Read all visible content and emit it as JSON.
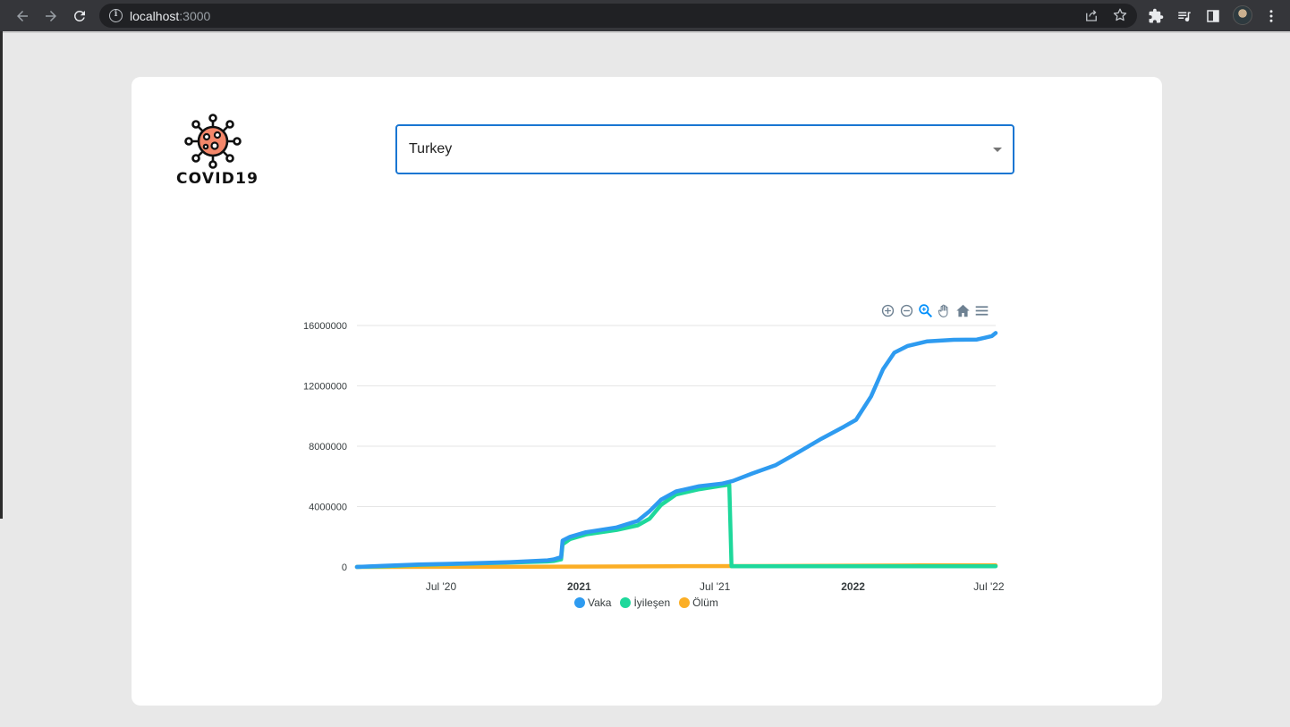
{
  "browser": {
    "url_host": "localhost",
    "url_port": ":3000"
  },
  "app": {
    "logo_text": "COVID19",
    "country_select": {
      "value": "Turkey"
    }
  },
  "chart_toolbar": [
    "zoom-in-icon",
    "zoom-out-icon",
    "selection-zoom-icon",
    "pan-icon",
    "reset-home-icon",
    "menu-icon"
  ],
  "colors": {
    "vaka": "#2e9bf0",
    "iyilesen": "#1ed89b",
    "olum": "#fbae25",
    "select_border": "#1976d2"
  },
  "chart_data": {
    "type": "line",
    "y_ticks": [
      "0",
      "4000000",
      "8000000",
      "12000000",
      "16000000"
    ],
    "x_ticks": [
      {
        "label": "Jul '20",
        "date": "2020-07-01",
        "bold": false
      },
      {
        "label": "2021",
        "date": "2021-01-01",
        "bold": true
      },
      {
        "label": "Jul '21",
        "date": "2021-07-01",
        "bold": false
      },
      {
        "label": "2022",
        "date": "2022-01-01",
        "bold": true
      },
      {
        "label": "Jul '22",
        "date": "2022-07-01",
        "bold": false
      }
    ],
    "ylim": [
      0,
      16000000
    ],
    "xlim": [
      "2020-03-11",
      "2022-07-10"
    ],
    "legend_position": "bottom",
    "series": [
      {
        "name": "Vaka",
        "points": [
          [
            "2020-03-11",
            0
          ],
          [
            "2020-04-15",
            70000
          ],
          [
            "2020-06-01",
            165000
          ],
          [
            "2020-08-01",
            232000
          ],
          [
            "2020-10-01",
            320000
          ],
          [
            "2020-11-20",
            440000
          ],
          [
            "2020-11-28",
            500000
          ],
          [
            "2020-12-08",
            650000
          ],
          [
            "2020-12-10",
            1750000
          ],
          [
            "2020-12-20",
            2000000
          ],
          [
            "2021-01-10",
            2300000
          ],
          [
            "2021-02-20",
            2620000
          ],
          [
            "2021-03-20",
            3050000
          ],
          [
            "2021-04-05",
            3700000
          ],
          [
            "2021-04-20",
            4450000
          ],
          [
            "2021-05-10",
            5000000
          ],
          [
            "2021-06-10",
            5350000
          ],
          [
            "2021-07-10",
            5520000
          ],
          [
            "2021-07-25",
            5700000
          ],
          [
            "2021-08-20",
            6200000
          ],
          [
            "2021-09-20",
            6750000
          ],
          [
            "2021-10-20",
            7600000
          ],
          [
            "2021-11-20",
            8500000
          ],
          [
            "2021-12-20",
            9300000
          ],
          [
            "2022-01-05",
            9750000
          ],
          [
            "2022-01-25",
            11300000
          ],
          [
            "2022-02-10",
            13100000
          ],
          [
            "2022-02-25",
            14200000
          ],
          [
            "2022-03-15",
            14650000
          ],
          [
            "2022-04-10",
            14950000
          ],
          [
            "2022-05-15",
            15050000
          ],
          [
            "2022-06-15",
            15070000
          ],
          [
            "2022-06-25",
            15180000
          ],
          [
            "2022-07-05",
            15300000
          ],
          [
            "2022-07-10",
            15500000
          ]
        ]
      },
      {
        "name": "İyileşen",
        "points": [
          [
            "2020-03-11",
            0
          ],
          [
            "2020-04-15",
            40000
          ],
          [
            "2020-06-01",
            140000
          ],
          [
            "2020-08-01",
            215000
          ],
          [
            "2020-10-01",
            290000
          ],
          [
            "2020-11-20",
            360000
          ],
          [
            "2020-11-28",
            390000
          ],
          [
            "2020-12-08",
            500000
          ],
          [
            "2020-12-10",
            1500000
          ],
          [
            "2020-12-20",
            1850000
          ],
          [
            "2021-01-10",
            2150000
          ],
          [
            "2021-02-20",
            2450000
          ],
          [
            "2021-03-20",
            2750000
          ],
          [
            "2021-04-05",
            3200000
          ],
          [
            "2021-04-20",
            4100000
          ],
          [
            "2021-05-10",
            4800000
          ],
          [
            "2021-06-10",
            5150000
          ],
          [
            "2021-07-10",
            5380000
          ],
          [
            "2021-07-20",
            5450000
          ],
          [
            "2021-07-23",
            50000
          ],
          [
            "2022-07-10",
            50000
          ]
        ]
      },
      {
        "name": "Ölüm",
        "points": [
          [
            "2020-03-11",
            0
          ],
          [
            "2020-10-01",
            8800
          ],
          [
            "2021-01-01",
            21000
          ],
          [
            "2021-05-01",
            45000
          ],
          [
            "2021-09-01",
            62000
          ],
          [
            "2022-01-01",
            83000
          ],
          [
            "2022-04-01",
            98000
          ],
          [
            "2022-07-10",
            99500
          ]
        ]
      }
    ]
  }
}
